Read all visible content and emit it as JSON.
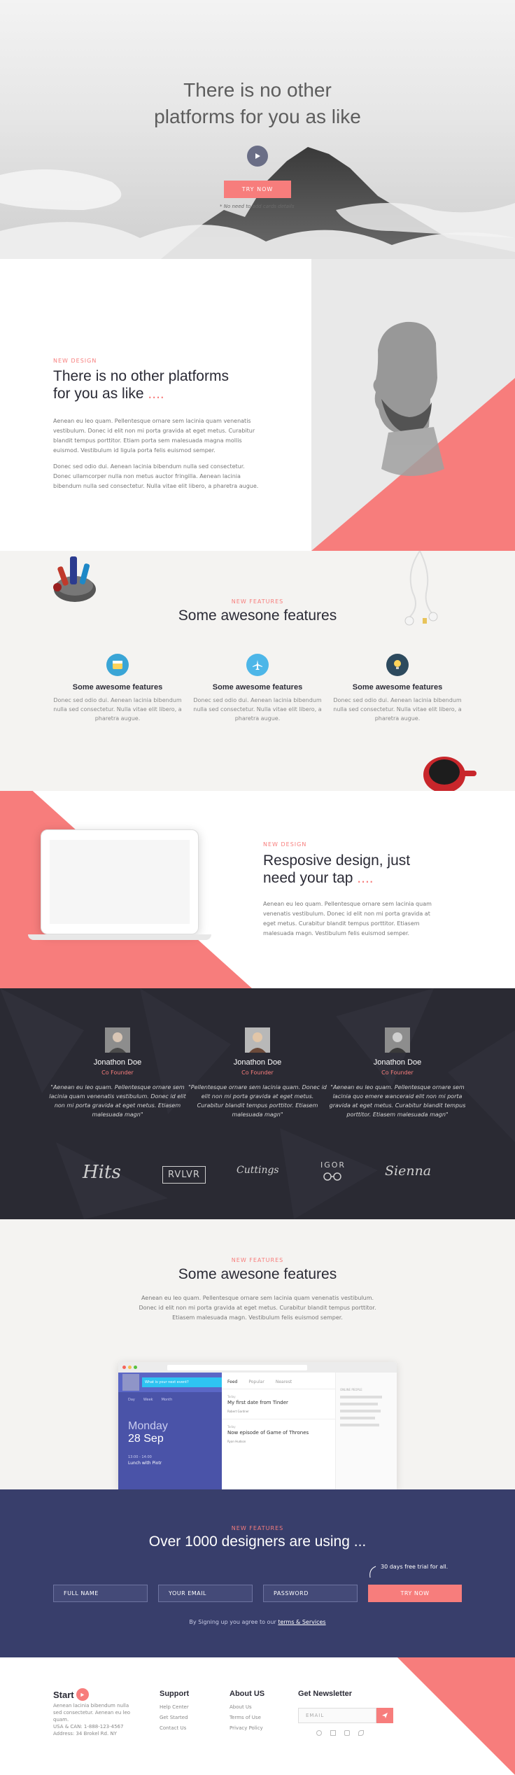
{
  "hero": {
    "title_line1": "There is no other",
    "title_line2": "platforms for you as like",
    "cta": "TRY NOW",
    "note": "* No need to add cards details"
  },
  "about": {
    "eyebrow": "NEW DESIGN",
    "title_line1": "There is no other platforms",
    "title_line2": "for you as like",
    "title_dots": "....",
    "para1": "Aenean eu leo quam. Pellentesque ornare sem lacinia quam venenatis vestibulum. Donec id elit non mi porta gravida at eget metus. Curabitur blandit tempus porttitor. Etiam porta sem malesuada magna mollis euismod. Vestibulum id ligula porta felis euismod semper.",
    "para2": "Donec sed odio dui. Aenean lacinia bibendum nulla sed consectetur. Donec ullamcorper nulla non metus auctor fringilla. Aenean lacinia bibendum nulla sed consectetur. Nulla vitae elit libero, a pharetra augue."
  },
  "features": {
    "eyebrow": "NEW FEATURES",
    "title": "Some awesone features",
    "items": [
      {
        "icon": "browser-icon",
        "title": "Some awesome features",
        "body": "Donec sed odio dui. Aenean lacinia bibendum nulla sed consectetur. Nulla vitae elit libero, a pharetra augue.",
        "color": "#3aa5d6"
      },
      {
        "icon": "airplane-icon",
        "title": "Some awesome features",
        "body": "Donec sed odio dui. Aenean lacinia bibendum nulla sed consectetur. Nulla vitae elit libero, a pharetra augue.",
        "color": "#4db6e8"
      },
      {
        "icon": "lightbulb-icon",
        "title": "Some awesome features",
        "body": "Donec sed odio dui. Aenean lacinia bibendum nulla sed consectetur. Nulla vitae elit libero, a pharetra augue.",
        "color": "#2d4a5e"
      }
    ]
  },
  "responsive": {
    "eyebrow": "NEW DESIGN",
    "title_line1": "Resposive design, just",
    "title_line2": "need your tap",
    "title_dots": "....",
    "body": "Aenean eu leo quam. Pellentesque ornare sem lacinia quam venenatis vestibulum. Donec id elit non mi porta gravida at eget metus. Curabitur blandit tempus porttitor. Etiasem malesuada magn. Vestibulum felis euismod semper."
  },
  "testimonials": [
    {
      "name": "Jonathon Doe",
      "role": "Co Founder",
      "quote": "\"Aenean eu leo quam. Pellentesque ornare sem lacinia quam venenatis vestibulum. Donec id elit non mi porta gravida at eget metus. Etiasem malesuada magn\""
    },
    {
      "name": "Jonathon Doe",
      "role": "Co Founder",
      "quote": "\"Pellentesque ornare sem lacinia quam. Donec id elit non mi porta gravida at eget metus. Curabitur blandit tempus porttitor. Etiasem malesuada magn\""
    },
    {
      "name": "Jonathon Doe",
      "role": "Co Founder",
      "quote": "\"Aenean eu leo quam. Pellentesque ornare sem lacinia quo emere wanceraid elit non mi porta gravida at eget metus. Curabitur blandit tempus porttitor. Etiasem malesuada magn\""
    }
  ],
  "logos": [
    "Hits",
    "RVLVR",
    "Cuttings",
    "IGOR",
    "Sienna"
  ],
  "features2": {
    "eyebrow": "NEW FEATURES",
    "title": "Some awesone features",
    "body": "Aenean eu leo quam. Pellentesque ornare sem lacinia quam venenatis vestibulum. Donec id elit non mi porta gravida at eget metus. Curabitur blandit tempus porttitor. Etiasem malesuada magn. Vestibulum felis euismod semper.",
    "app": {
      "search_placeholder": "What is your next event?",
      "tabs": [
        "Day",
        "Week",
        "Month"
      ],
      "day": "Monday",
      "date": "28 Sep",
      "event_time": "13:00 - 14:00",
      "event": "Lunch with Piotr",
      "feed_tabs": [
        "Feed",
        "Popular",
        "Nearest"
      ],
      "posts": [
        {
          "title": "My first date from Tinder",
          "author": "Robert Gardner",
          "label": "Today"
        },
        {
          "title": "Now episode of Game of Thrones",
          "author": "Ryan Hudson",
          "label": "Today"
        }
      ],
      "online_label": "ONLINE PEOPLE"
    }
  },
  "signup": {
    "eyebrow": "NEW FEATURES",
    "title": "Over 1000 designers are using ...",
    "trial": "30 days free trial for all.",
    "fields": [
      "FULL NAME",
      "YOUR EMAIL",
      "PASSWORD"
    ],
    "submit": "TRY NOW",
    "terms_prefix": "By Signing up you agree to our",
    "terms_link": "terms & Services"
  },
  "footer": {
    "brand": "Start",
    "about_text": "Aenean lacinia bibendum nulla sed consectetur. Aenean eu leo quam.",
    "address": "USA & CAN: 1-888-123-4567",
    "address2": "Address: 34 Brokel Rd. NY",
    "support_title": "Support",
    "support_links": [
      "Help Center",
      "Get Started",
      "Contact Us"
    ],
    "about_title": "About US",
    "about_links": [
      "About Us",
      "Terms of Use",
      "Privacy Policy"
    ],
    "newsletter_title": "Get Newsletter",
    "email_placeholder": "EMAIL"
  },
  "colors": {
    "accent": "#f77d7c",
    "navy": "#383e6b",
    "dark": "#2a2a33"
  }
}
